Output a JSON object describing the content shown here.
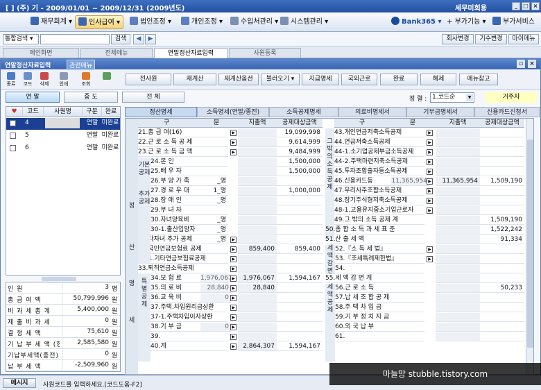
{
  "titlebar": {
    "title": "[ ] (주) 기 - 2009/01/01 ~ 2009/12/31 (2009년도)",
    "right": "세무미회용",
    "right_small": "환경설정"
  },
  "menu": [
    {
      "label": "재무회계",
      "color": "#3a66b4"
    },
    {
      "label": "인사급여",
      "color": "#3a66b4"
    },
    {
      "label": "법인조정",
      "color": "#5b7fc0"
    },
    {
      "label": "개인조정",
      "color": "#5b7fc0"
    },
    {
      "label": "수입처관리",
      "color": "#7b8fb0"
    },
    {
      "label": "시스템관리",
      "color": "#7b8fb0"
    }
  ],
  "menu_right": {
    "bank": "Bank365",
    "func": "부가기능",
    "svc": "부가서비스"
  },
  "search": {
    "label": "통합검색",
    "btn": "검색",
    "change_company": "회사변경",
    "change_year": "기수변경",
    "mypage": "마이메뉴"
  },
  "tabs": [
    "메인화면",
    "전체메뉴",
    "연말정산자료입력",
    "사원등록"
  ],
  "window": {
    "title": "연말정산자료입력",
    "menu": "관련메뉴"
  },
  "toolbar_icons": [
    "종료",
    "코드",
    "삭제",
    "인쇄",
    "조회"
  ],
  "toolbar_buttons": [
    "전사원",
    "재계산",
    "재계산옵션",
    "불러오기",
    "지급명세",
    "국외근로",
    "완료",
    "해제",
    "메뉴참고"
  ],
  "radios": [
    "연 말",
    "중 도",
    "전 체"
  ],
  "sort": {
    "label": "정 렬 :",
    "value": "1.코드순",
    "resident": "거주자"
  },
  "emp_headers": [
    "코드",
    "사원명",
    "구분",
    "완료"
  ],
  "employees": [
    {
      "code": "4",
      "name": "",
      "type": "연말",
      "done": "미완료"
    },
    {
      "code": "5",
      "name": "",
      "type": "연말",
      "done": "미완료"
    },
    {
      "code": "6",
      "name": "",
      "type": "연말",
      "done": "미완료"
    }
  ],
  "summary": [
    {
      "k": "인 원",
      "v": "3",
      "u": "명"
    },
    {
      "k": "총 급 여 액",
      "v": "50,799,996",
      "u": "원"
    },
    {
      "k": "비 과 세 총 계",
      "v": "5,400,000",
      "u": "원"
    },
    {
      "k": "제 출 비 과 세",
      "v": "0",
      "u": "원"
    },
    {
      "k": "결 정 세 액",
      "v": "75,610",
      "u": "원"
    },
    {
      "k": "기 납 부 세 액 (현)",
      "v": "2,585,580",
      "u": "원"
    },
    {
      "k": "기납부세액(종전)",
      "v": "0",
      "u": "원"
    },
    {
      "k": "납 부 세 액",
      "v": "-2,509,960",
      "u": "원"
    }
  ],
  "right_tabs": [
    "정산명세",
    "소득명세(연말/종전)",
    "소득공제명세",
    "의료비명세서",
    "기부금명세서",
    "신용카드신청서"
  ],
  "headers": {
    "gu": "구",
    "bun": "분",
    "amt": "지출액",
    "target": "공제대상금액"
  },
  "vlabels": {
    "jeong": "정",
    "san": "산",
    "myeong": "명",
    "se": "세",
    "gibon": "기본\n공제",
    "chuga": "추가\n공제",
    "teuk": "특\n별\n공\n제",
    "geumyung": "그\n밖\n의\n소\n득\n공\n제",
    "sae": "세\n액\n감\n면",
    "sae2": "세\n액\n공\n제"
  },
  "left_rows": [
    {
      "label": "21.총 급 여(16)",
      "amt": "",
      "target": "19,099,998"
    },
    {
      "label": "22.근 로 소 득 공 제",
      "amt": "",
      "target": "9,614,999"
    },
    {
      "label": "23.근 로 소 득 금 액",
      "amt": "",
      "target": "9,484,999"
    },
    {
      "label": "24.본 인",
      "amt": "",
      "target": "1,500,000"
    },
    {
      "label": "25.배 우 자",
      "amt": "",
      "target": "1,500,000"
    },
    {
      "label": "26.부 양 가 족",
      "cnt": "_명",
      "amt": "",
      "target": ""
    },
    {
      "label": "27.경 로 우 대",
      "cnt": "1_명",
      "amt": "",
      "target": "1,000,000"
    },
    {
      "label": "28.장 애 인",
      "cnt": "_명",
      "amt": "",
      "target": ""
    },
    {
      "label": "29.부 녀 자",
      "cnt": "",
      "amt": "",
      "target": ""
    },
    {
      "label": "30.자녀양육비",
      "cnt": "_명",
      "amt": "",
      "target": ""
    },
    {
      "label": "30-1.출산입양자",
      "cnt": "_명",
      "amt": "",
      "target": ""
    },
    {
      "label": "31.다자녀 추가 공제",
      "cnt": "_명",
      "amt": "",
      "target": ""
    },
    {
      "label": "32.국민연금보험료 공제",
      "amt": "859,400",
      "target": "859,400"
    },
    {
      "label": "32-1.기타연금보험료공제",
      "amt": "",
      "target": ""
    },
    {
      "label": "33.퇴직연금소득공제",
      "amt": "",
      "target": ""
    },
    {
      "label": "34.보 험 료",
      "sub": "1,976,067",
      "amt": "1,976,067",
      "target": "1,594,167"
    },
    {
      "label": "35.의 료 비",
      "sub": "28,840",
      "amt": "28,840",
      "target": ""
    },
    {
      "label": "36.교 육 비",
      "sub": "0",
      "amt": "",
      "target": ""
    },
    {
      "label": "37.주택.차입원리금상환",
      "amt": "",
      "target": ""
    },
    {
      "label": "37-1.주택차입이자상환",
      "amt": "",
      "target": ""
    },
    {
      "label": "38.기 부 금",
      "sub": "0",
      "amt": "",
      "target": ""
    },
    {
      "label": "39.",
      "amt": "",
      "target": ""
    },
    {
      "label": "40.계",
      "amt": "2,864,307",
      "target": "1,594,167"
    }
  ],
  "right_rows": [
    {
      "label": "43.개인연금저축소득공제",
      "amt": "",
      "target": ""
    },
    {
      "label": "44.연금저축소득공제",
      "amt": "",
      "target": ""
    },
    {
      "label": "44-1.소기업공제부금소득공제",
      "amt": "",
      "target": ""
    },
    {
      "label": "44-2.주택마련저축소득공제",
      "amt": "",
      "target": ""
    },
    {
      "label": "45.투자조합출자등소득공제",
      "amt": "",
      "target": ""
    },
    {
      "label": "46.신용카드등",
      "sub": "11,365,954",
      "amt": "11,365,954",
      "target": "1,509,190"
    },
    {
      "label": "47.우리사주조합소득공제",
      "amt": "",
      "target": ""
    },
    {
      "label": "48.장기주식형저축소득공제",
      "amt": "",
      "target": ""
    },
    {
      "label": "48-1.고용유지중소기업근로자",
      "amt": "",
      "target": ""
    },
    {
      "label": "49.그 밖의 소득 공제 계",
      "amt": "",
      "target": "1,509,190"
    },
    {
      "label": "50.종 합 소 득 과 세 표 준",
      "amt": "",
      "target": "1,522,242"
    },
    {
      "label": "51.산 출 세 액",
      "amt": "",
      "target": "91,334"
    },
    {
      "label": "52.『소 득 세 법』",
      "amt": "",
      "target": ""
    },
    {
      "label": "53.『조세특례제한법』",
      "amt": "",
      "target": ""
    },
    {
      "label": "54.",
      "amt": "",
      "target": ""
    },
    {
      "label": "55.세 액 감 면 계",
      "amt": "",
      "target": ""
    },
    {
      "label": "56.근 로 소 득",
      "amt": "",
      "target": "50,233"
    },
    {
      "label": "57.납 세 조 합 공 제",
      "amt": "",
      "target": ""
    },
    {
      "label": "58.주 택 차 입 금",
      "amt": "",
      "target": ""
    },
    {
      "label": "59.기 부 정 치 자 금",
      "amt": "",
      "target": ""
    },
    {
      "label": "60.외 국 납 부",
      "amt": "",
      "target": ""
    },
    {
      "label": "61.",
      "amt": "",
      "target": ""
    }
  ],
  "status": {
    "label": "메시지",
    "text": "사원코드를 입력하세요.[코드도움-F2]"
  },
  "watermark": "마늘망 stubble.tistory.com"
}
